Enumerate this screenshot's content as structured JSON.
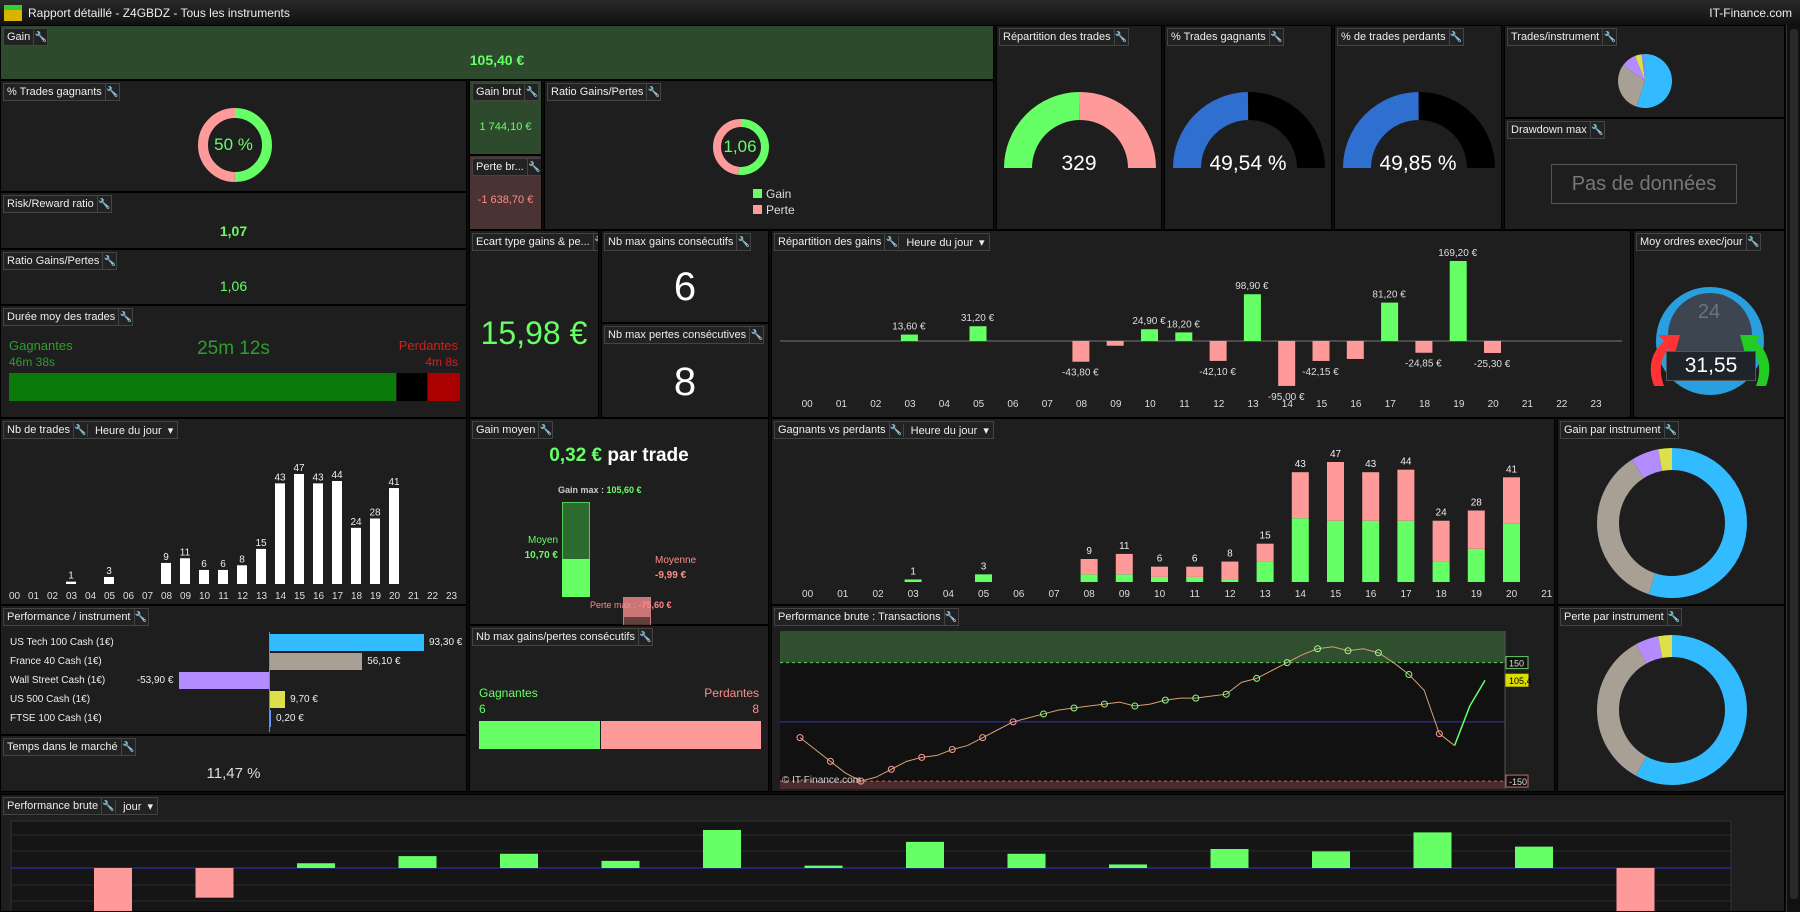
{
  "window": {
    "title": "Rapport détaillé - Z4GBDZ - Tous les instruments",
    "brand": "IT-Finance.com",
    "logo": "DEMO"
  },
  "colors": {
    "green": "#66ff66",
    "pink": "#ff9a9a",
    "blue": "#33bbff",
    "grey": "#a89f95",
    "purple": "#b38cff",
    "yellow": "#dde04a",
    "gain_bg": "#2d4a2d",
    "loss_bg": "#4a3333"
  },
  "gain": {
    "title": "Gain",
    "value": "105,40 €"
  },
  "pct_trades": {
    "title": "% Trades gagnants",
    "value": "50 %",
    "fraction": 0.5
  },
  "gain_brut": {
    "title": "Gain brut",
    "value": "1 744,10 €"
  },
  "perte_brute": {
    "title": "Perte br...",
    "value": "-1 638,70 €"
  },
  "ratio_chart": {
    "title": "Ratio Gains/Pertes",
    "value": "1,06",
    "legend": [
      "Gain",
      "Perte"
    ],
    "gain": 1744.1,
    "perte": 1638.7
  },
  "risk_reward": {
    "title": "Risk/Reward ratio",
    "value": "1,07"
  },
  "ratio": {
    "title": "Ratio Gains/Pertes",
    "value": "1,06"
  },
  "duree": {
    "title": "Durée moy des trades",
    "win_label": "Gagnantes",
    "win_value": "46m 38s",
    "avg": "25m 12s",
    "loss_label": "Perdantes",
    "loss_value": "4m 8s"
  },
  "repartition_trades": {
    "title": "Répartition des trades",
    "value": "329",
    "wins": 163,
    "losses": 166
  },
  "pct_gagnants": {
    "title": "% Trades gagnants",
    "value": "49,54 %",
    "fraction": 0.4954
  },
  "pct_perdants": {
    "title": "% de trades perdants",
    "value": "49,85 %",
    "fraction": 0.4985
  },
  "trades_instrument": {
    "title": "Trades/instrument",
    "values": [
      55,
      30,
      9,
      4,
      2
    ]
  },
  "drawdown": {
    "title": "Drawdown max",
    "value": "Pas de données"
  },
  "ecart": {
    "title": "Ecart type gains & pe...",
    "value": "15,98 €"
  },
  "max_gains": {
    "title": "Nb max gains consécutifs",
    "value": "6"
  },
  "max_pertes": {
    "title": "Nb max pertes consécutives",
    "value": "8"
  },
  "moy_ordres": {
    "title": "Moy ordres exec/jour",
    "value": "31,55",
    "clock": "24"
  },
  "gain_moyen": {
    "title": "Gain moyen",
    "value": "0,32 €",
    "suffix": "par trade",
    "gain_max_label": "Gain max :",
    "gain_max": "105,60 €",
    "moyen_label": "Moyen",
    "moyen": "10,70 €",
    "moyenne_label": "Moyenne",
    "moyenne": "-9,99 €",
    "perte_max_label": "Perte max :",
    "perte_max": "-75,60 €"
  },
  "consec": {
    "title": "Nb max gains/pertes consécutifs",
    "win_label": "Gagnantes",
    "win": 6,
    "loss_label": "Perdantes",
    "loss": 8
  },
  "perf_instr": {
    "title": "Performance / instrument",
    "items": [
      {
        "name": "US Tech 100 Cash (1€)",
        "value": 93.3,
        "label": "93,30 €",
        "color": "#33bbff"
      },
      {
        "name": "France 40 Cash (1€)",
        "value": 56.1,
        "label": "56,10 €",
        "color": "#a89f95"
      },
      {
        "name": "Wall Street Cash (1€)",
        "value": -53.9,
        "label": "-53,90 €",
        "color": "#b38cff"
      },
      {
        "name": "US 500 Cash (1€)",
        "value": 9.7,
        "label": "9,70 €",
        "color": "#dde04a"
      },
      {
        "name": "FTSE 100 Cash (1€)",
        "value": 0.2,
        "label": "0,20 €",
        "color": "#6699ff"
      }
    ]
  },
  "temps": {
    "title": "Temps dans le marché",
    "value": "11,47 %"
  },
  "gain_par_instr": {
    "title": "Gain par instrument",
    "values": [
      55,
      36,
      6,
      3
    ]
  },
  "perte_par_instr": {
    "title": "Perte par instrument",
    "values": [
      58,
      34,
      5,
      3
    ]
  },
  "perf_trans": {
    "title": "Performance brute : Transactions",
    "watermark": "© IT-Finance.com",
    "labels": [
      "150",
      "105,4",
      "-150"
    ]
  },
  "perf_brute": {
    "title": "Performance brute",
    "period": "jour"
  },
  "chart_data": [
    {
      "type": "bar",
      "title": "Nb de trades",
      "selector": "Heure du jour",
      "categories": [
        "00",
        "01",
        "02",
        "03",
        "04",
        "05",
        "06",
        "07",
        "08",
        "09",
        "10",
        "11",
        "12",
        "13",
        "14",
        "15",
        "16",
        "17",
        "18",
        "19",
        "20",
        "21",
        "22",
        "23"
      ],
      "values": [
        0,
        0,
        0,
        1,
        0,
        3,
        0,
        0,
        9,
        11,
        6,
        6,
        8,
        15,
        43,
        47,
        43,
        44,
        24,
        28,
        41,
        0,
        0,
        0
      ]
    },
    {
      "type": "bar",
      "title": "Répartition des gains",
      "selector": "Heure du jour",
      "categories": [
        "00",
        "01",
        "02",
        "03",
        "04",
        "05",
        "06",
        "07",
        "08",
        "09",
        "10",
        "11",
        "12",
        "13",
        "14",
        "15",
        "16",
        "17",
        "18",
        "19",
        "20",
        "21",
        "22",
        "23"
      ],
      "values": [
        0,
        0,
        0,
        13.6,
        0,
        31.2,
        0,
        0,
        -43.8,
        -10,
        24.9,
        18.2,
        -42.1,
        98.9,
        -95,
        -42.15,
        -38,
        81.2,
        -24.85,
        169.2,
        -25.3,
        0,
        0,
        0
      ],
      "labels": [
        "",
        "",
        "",
        "13,60 €",
        "",
        "31,20 €",
        "",
        "",
        "-43,80 €",
        "",
        "24,90 €",
        "18,20 €",
        "-42,10 €",
        "98,90 €",
        "-95,00 €",
        "-42,15 €",
        "",
        "81,20 €",
        "-24,85 €",
        "169,20 €",
        "-25,30 €",
        "",
        "",
        ""
      ]
    },
    {
      "type": "bar",
      "title": "Gagnants vs perdants",
      "selector": "Heure du jour",
      "categories": [
        "00",
        "01",
        "02",
        "03",
        "04",
        "05",
        "06",
        "07",
        "08",
        "09",
        "10",
        "11",
        "12",
        "13",
        "14",
        "15",
        "16",
        "17",
        "18",
        "19",
        "20",
        "21"
      ],
      "series": [
        {
          "values": [
            0,
            0,
            0,
            1,
            0,
            3,
            0,
            0,
            3,
            3,
            2,
            2,
            1,
            8,
            25,
            24,
            24,
            24,
            8,
            13,
            23,
            0
          ]
        },
        {
          "values": [
            0,
            0,
            0,
            0,
            0,
            0,
            0,
            0,
            6,
            8,
            4,
            4,
            7,
            7,
            18,
            23,
            19,
            20,
            16,
            15,
            18,
            0
          ]
        }
      ],
      "totals": [
        0,
        0,
        0,
        1,
        0,
        3,
        0,
        0,
        9,
        11,
        6,
        6,
        8,
        15,
        43,
        47,
        43,
        44,
        24,
        28,
        41,
        0
      ]
    },
    {
      "type": "line",
      "title": "Performance brute : Transactions",
      "values": [
        -40,
        -70,
        -100,
        -130,
        -150,
        -140,
        -120,
        -100,
        -90,
        -85,
        -70,
        -60,
        -40,
        -20,
        0,
        10,
        20,
        30,
        35,
        40,
        45,
        50,
        40,
        45,
        55,
        60,
        60,
        65,
        70,
        100,
        110,
        130,
        150,
        170,
        185,
        190,
        180,
        185,
        175,
        150,
        120,
        80,
        -30,
        -60,
        40,
        105.4
      ],
      "ylim": [
        -170,
        230
      ]
    },
    {
      "type": "bar",
      "title": "Performance brute",
      "values": [
        -40,
        -25,
        4,
        10,
        12,
        6,
        32,
        2,
        22,
        12,
        3,
        16,
        14,
        30,
        18,
        -40
      ]
    }
  ]
}
